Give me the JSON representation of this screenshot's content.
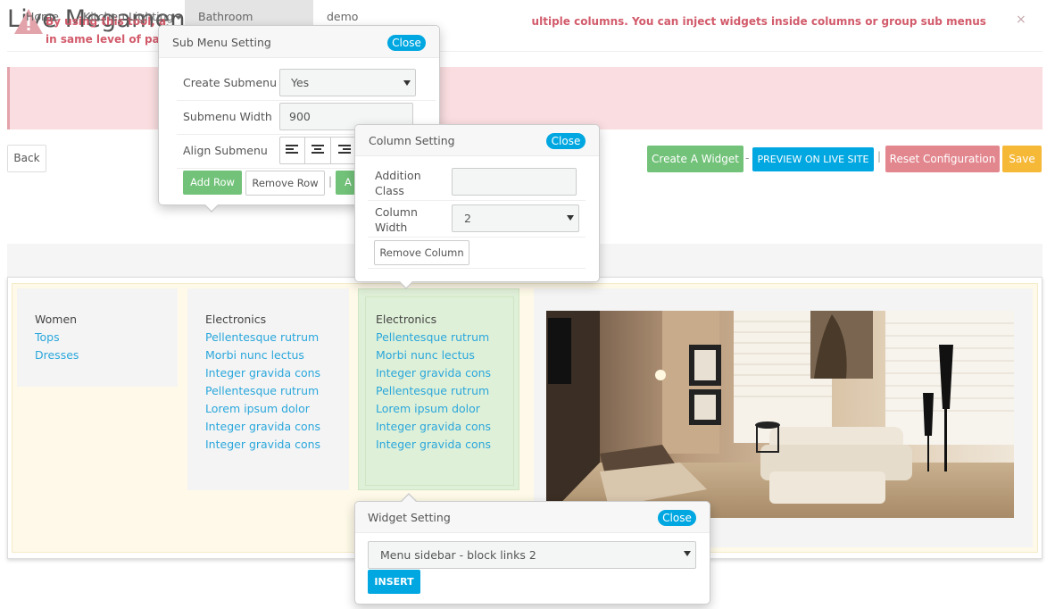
{
  "page": {
    "title": "Live Megamenu Editor",
    "alert_text": "By using this tool, a                                                                                                  ultiple columns. You can inject widgets inside columns or group sub menus in same level of parent.Note: Some configuration",
    "alert_close": "×"
  },
  "toolbar": {
    "back": "Back",
    "create_widget": "Create A Widget",
    "dash": "-",
    "preview": "PREVIEW ON LIVE SITE",
    "bar": "|",
    "reset": "Reset Configuration",
    "save": "Save"
  },
  "nav": {
    "items": [
      {
        "label": "Home",
        "dropdown": false
      },
      {
        "label": "Kitchen Lighting",
        "dropdown": true
      },
      {
        "label": "Bathroom Lighting",
        "dropdown": true
      },
      {
        "label": "demo",
        "dropdown": false
      }
    ]
  },
  "columns": [
    {
      "heading": "Women",
      "links": [
        "Tops",
        "Dresses"
      ]
    },
    {
      "heading": "Electronics",
      "links": [
        "Pellentesque rutrum",
        "Morbi nunc lectus",
        "Integer gravida cons",
        "Pellentesque rutrum",
        "Lorem ipsum dolor",
        "Integer gravida cons",
        "Integer gravida cons"
      ]
    },
    {
      "heading": "Electronics",
      "links": [
        "Pellentesque rutrum",
        "Morbi nunc lectus",
        "Integer gravida cons",
        "Pellentesque rutrum",
        "Lorem ipsum dolor",
        "Integer gravida cons",
        "Integer gravida cons"
      ]
    }
  ],
  "submenu_popup": {
    "title": "Sub Menu Setting",
    "close": "Close",
    "create_label": "Create Submenu",
    "create_value": "Yes",
    "width_label": "Submenu Width",
    "width_value": "900",
    "align_label": "Align Submenu",
    "add_row": "Add Row",
    "remove_row": "Remove Row",
    "bar": "|",
    "add_col_partial": "A"
  },
  "column_popup": {
    "title": "Column Setting",
    "close": "Close",
    "class_label_1": "Addition",
    "class_label_2": "Class",
    "class_value": "",
    "width_label_1": "Column",
    "width_label_2": "Width",
    "width_value": "2",
    "remove_column": "Remove Column"
  },
  "widget_popup": {
    "title": "Widget Setting",
    "close": "Close",
    "select_value": "Menu sidebar - block links 2",
    "insert": "INSERT"
  },
  "colors": {
    "green": "#72c279",
    "blue": "#00a7e1",
    "red": "#e3878f",
    "orange": "#f6b837",
    "link": "#2aa7dc",
    "alert_bg": "#f9dde0"
  }
}
